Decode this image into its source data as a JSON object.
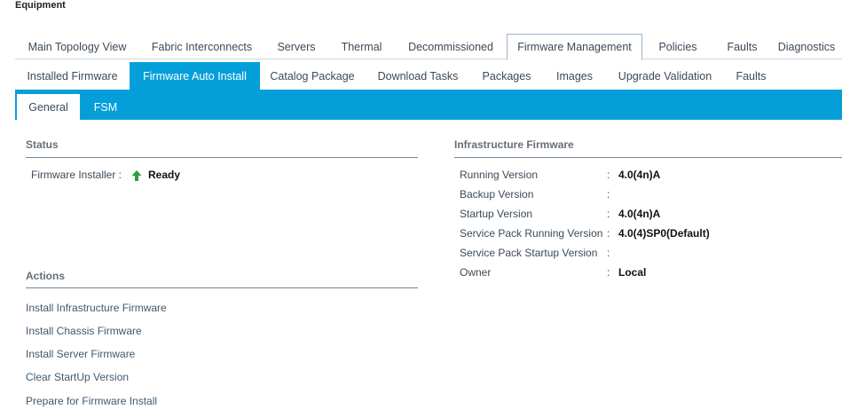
{
  "page": {
    "title": "Equipment"
  },
  "top_tabs": [
    {
      "label": "Main Topology View"
    },
    {
      "label": "Fabric Interconnects"
    },
    {
      "label": "Servers"
    },
    {
      "label": "Thermal"
    },
    {
      "label": "Decommissioned"
    },
    {
      "label": "Firmware Management",
      "active": true
    },
    {
      "label": "Policies"
    },
    {
      "label": "Faults"
    },
    {
      "label": "Diagnostics"
    }
  ],
  "sub_tabs": [
    {
      "label": "Installed Firmware"
    },
    {
      "label": "Firmware Auto Install",
      "active": true
    },
    {
      "label": "Catalog Package"
    },
    {
      "label": "Download Tasks"
    },
    {
      "label": "Packages"
    },
    {
      "label": "Images"
    },
    {
      "label": "Upgrade Validation"
    },
    {
      "label": "Faults"
    }
  ],
  "detail_tabs": [
    {
      "label": "General",
      "active": true
    },
    {
      "label": "FSM"
    }
  ],
  "status": {
    "title": "Status",
    "installer_label": "Firmware Installer :",
    "installer_value": "Ready",
    "icon": "arrow-up-icon",
    "icon_color": "#2e9e3a"
  },
  "actions": {
    "title": "Actions",
    "items": [
      "Install Infrastructure Firmware",
      "Install Chassis Firmware",
      "Install Server Firmware",
      "Clear StartUp Version",
      "Prepare for Firmware Install"
    ]
  },
  "infrastructure": {
    "title": "Infrastructure Firmware",
    "colon": ":",
    "rows": [
      {
        "label": "Running Version",
        "value": "4.0(4n)A"
      },
      {
        "label": "Backup Version",
        "value": ""
      },
      {
        "label": "Startup Version",
        "value": "4.0(4n)A"
      },
      {
        "label": "Service Pack Running Version",
        "value": "4.0(4)SP0(Default)"
      },
      {
        "label": "Service Pack Startup Version",
        "value": ""
      },
      {
        "label": "Owner",
        "value": "Local"
      }
    ]
  },
  "colors": {
    "accent": "#049fd9"
  }
}
